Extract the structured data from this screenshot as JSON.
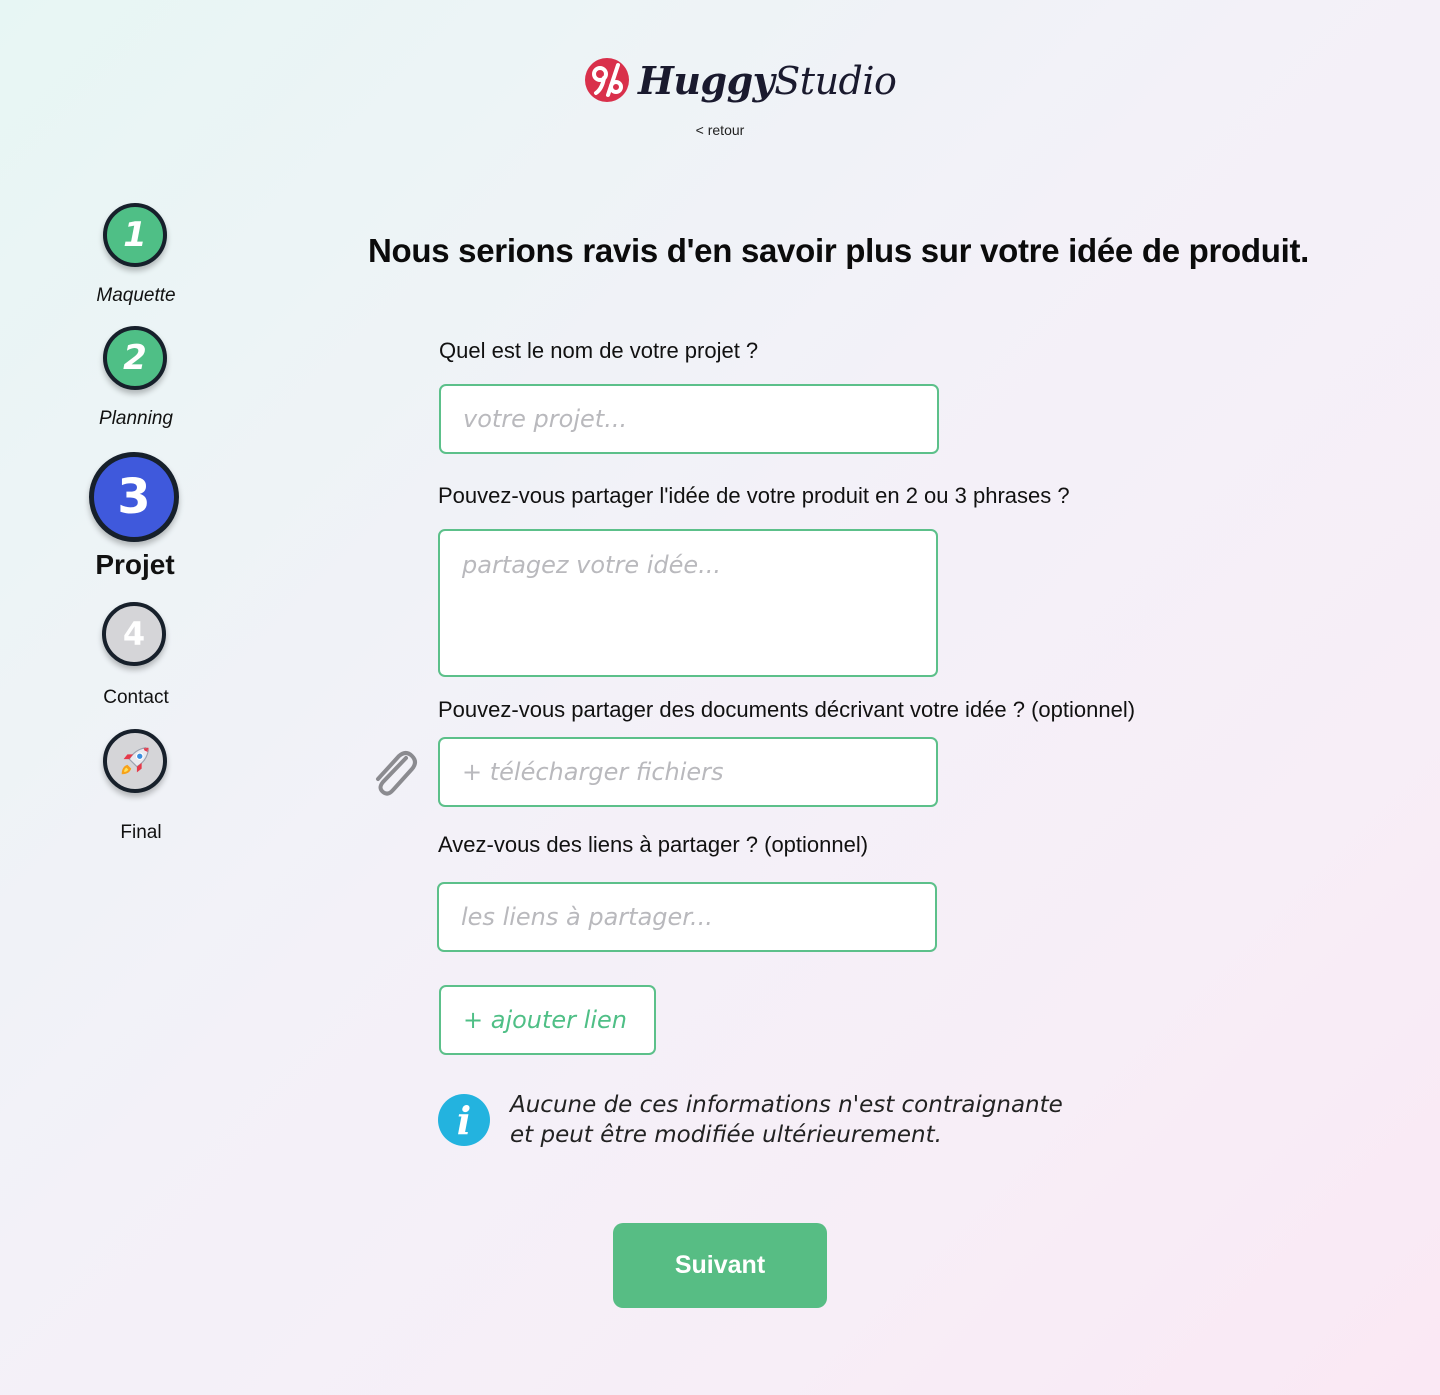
{
  "header": {
    "brand_bold": "Huggy",
    "brand_regular": "Studio",
    "back_label": "< retour"
  },
  "steps": [
    {
      "number": "1",
      "label": "Maquette",
      "state": "done"
    },
    {
      "number": "2",
      "label": "Planning",
      "state": "done"
    },
    {
      "number": "3",
      "label": "Projet",
      "state": "active"
    },
    {
      "number": "4",
      "label": "Contact",
      "state": "todo"
    },
    {
      "icon": "rocket-icon",
      "label": "Final",
      "state": "todo"
    }
  ],
  "main": {
    "title": "Nous serions ravis d'en savoir plus sur votre idée de produit.",
    "project_name": {
      "label": "Quel est le nom de votre projet ?",
      "placeholder": "votre projet..."
    },
    "idea": {
      "label": "Pouvez-vous partager l'idée de votre produit en 2 ou 3 phrases ?",
      "placeholder": "partagez votre idée..."
    },
    "documents": {
      "label": "Pouvez-vous partager des documents décrivant votre idée ? (optionnel)",
      "placeholder": "+ télécharger fichiers"
    },
    "links": {
      "label": "Avez-vous des liens à partager ? (optionnel)",
      "placeholder": "les liens à partager..."
    },
    "add_link_label": "+ ajouter lien",
    "info_line1": "Aucune de ces informations n'est contraignante",
    "info_line2": "et peut être modifiée ultérieurement.",
    "next_label": "Suivant"
  },
  "colors": {
    "accent_green": "#57bd84",
    "active_blue": "#3f59dc",
    "info_blue": "#23b3df",
    "brand_red": "#d9304b"
  }
}
